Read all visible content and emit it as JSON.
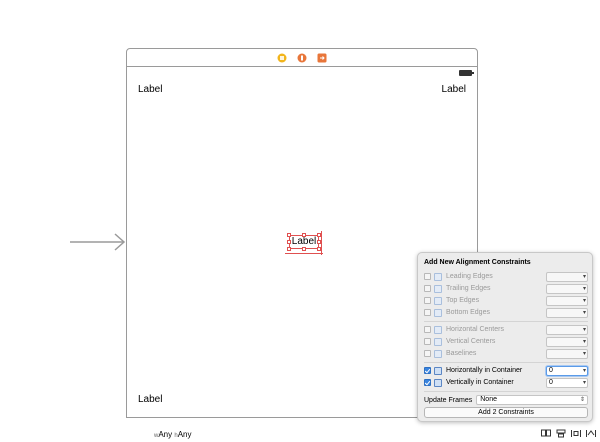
{
  "scene": {
    "labels": {
      "top_left": "Label",
      "top_right": "Label",
      "center": "Label",
      "bottom_left": "Label"
    },
    "dock_icons": [
      "view-controller-icon",
      "first-responder-icon",
      "exit-icon"
    ]
  },
  "popover": {
    "title": "Add New Alignment Constraints",
    "edge_rows": [
      {
        "label": "Leading Edges",
        "checked": false,
        "enabled": false,
        "value": ""
      },
      {
        "label": "Trailing Edges",
        "checked": false,
        "enabled": false,
        "value": ""
      },
      {
        "label": "Top Edges",
        "checked": false,
        "enabled": false,
        "value": ""
      },
      {
        "label": "Bottom Edges",
        "checked": false,
        "enabled": false,
        "value": ""
      }
    ],
    "center_rows": [
      {
        "label": "Horizontal Centers",
        "checked": false,
        "enabled": false,
        "value": ""
      },
      {
        "label": "Vertical Centers",
        "checked": false,
        "enabled": false,
        "value": ""
      },
      {
        "label": "Baselines",
        "checked": false,
        "enabled": false,
        "value": ""
      }
    ],
    "container_rows": [
      {
        "label": "Horizontally in Container",
        "checked": true,
        "enabled": true,
        "value": "0"
      },
      {
        "label": "Vertically in Container",
        "checked": true,
        "enabled": true,
        "value": "0"
      }
    ],
    "update_frames_label": "Update Frames",
    "update_frames_value": "None",
    "add_button_label": "Add 2 Constraints"
  },
  "bottom_bar": {
    "width_prefix": "w",
    "width_value": "Any",
    "height_prefix": "h",
    "height_value": "Any"
  },
  "colors": {
    "accent": "#3a85e0",
    "selection": "#e05050",
    "dock_yellow": "#f2b51c",
    "dock_orange": "#e8763a"
  }
}
